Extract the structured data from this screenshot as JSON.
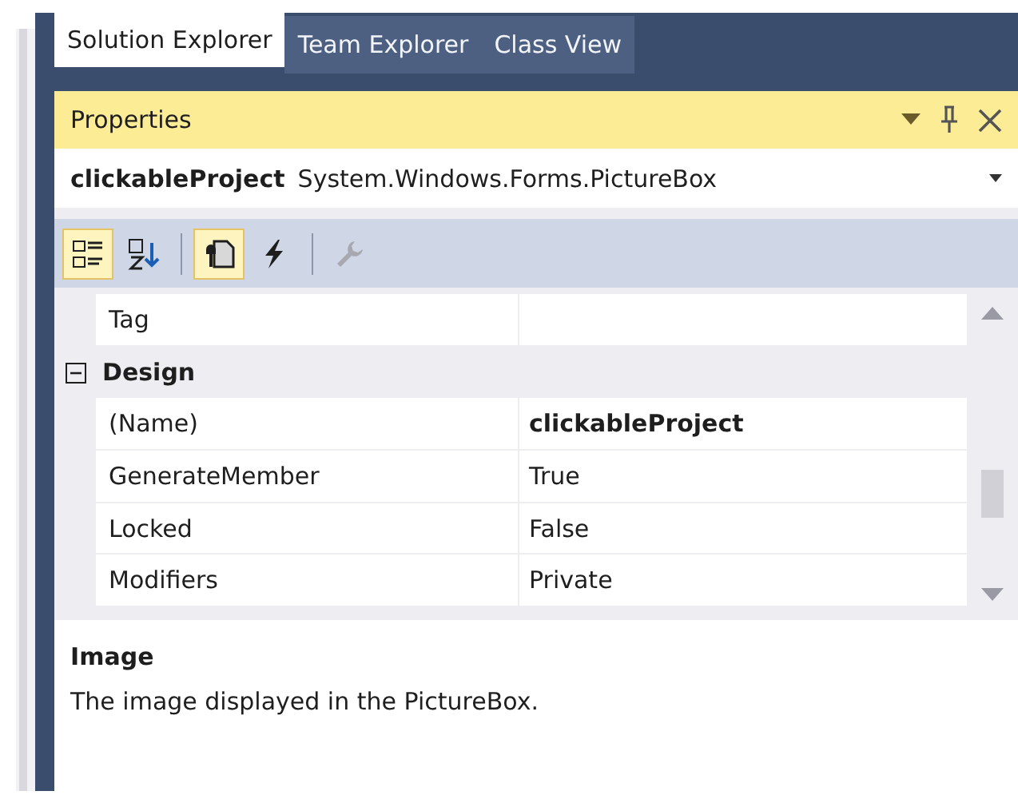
{
  "tabs": [
    {
      "label": "Solution Explorer",
      "selected": true
    },
    {
      "label": "Team Explorer",
      "selected": false
    },
    {
      "label": "Class View",
      "selected": false
    }
  ],
  "panel": {
    "title": "Properties"
  },
  "object_selector": {
    "name": "clickableProject",
    "type": "System.Windows.Forms.PictureBox"
  },
  "toolbar": [
    {
      "kind": "categorized",
      "selected": true,
      "disabled": false
    },
    {
      "kind": "alphabetical",
      "selected": false,
      "disabled": false
    },
    {
      "kind": "separator"
    },
    {
      "kind": "properties",
      "selected": true,
      "disabled": false
    },
    {
      "kind": "events",
      "selected": false,
      "disabled": false
    },
    {
      "kind": "separator"
    },
    {
      "kind": "property-pages",
      "selected": false,
      "disabled": true
    }
  ],
  "grid": [
    {
      "kind": "property",
      "name": "Tag"
    },
    {
      "kind": "category",
      "name": "Design",
      "expanded": true
    },
    {
      "kind": "property",
      "name": "(Name)",
      "value": "clickableProject",
      "modified": true
    },
    {
      "kind": "property",
      "name": "GenerateMember",
      "value": "True",
      "modified": false
    },
    {
      "kind": "property",
      "name": "Locked",
      "value": "False",
      "modified": false
    },
    {
      "kind": "property",
      "name": "Modifiers",
      "value": "Private",
      "modified": false
    }
  ],
  "description": {
    "title": "Image",
    "text": "The image displayed in the PictureBox."
  }
}
